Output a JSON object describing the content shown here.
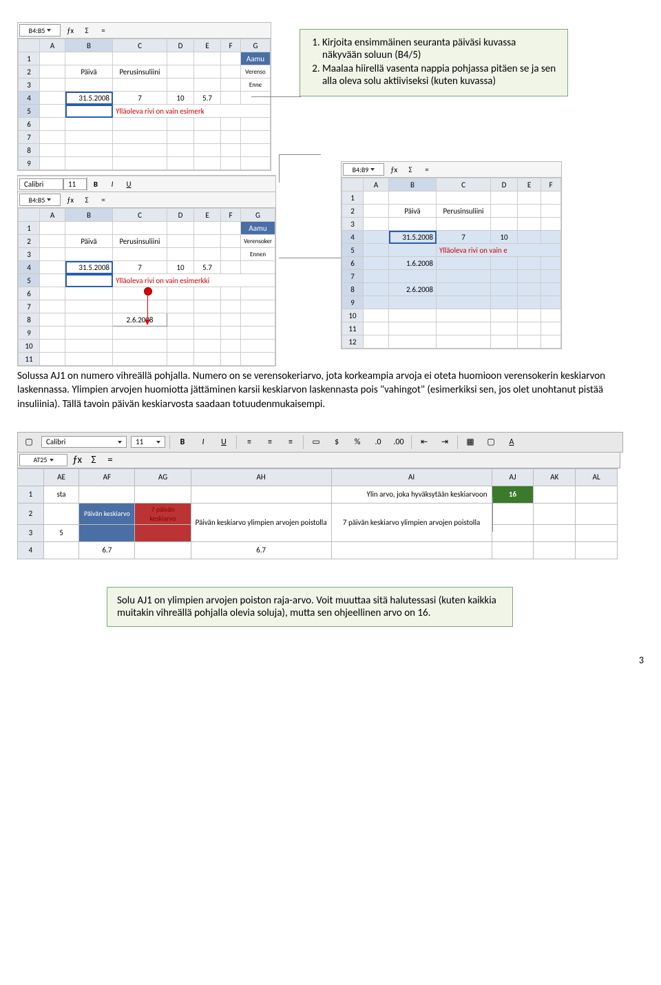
{
  "callout1": {
    "items": [
      "Kirjoita ensimmäinen seuranta päiväsi kuvassa näkyvään soluun (B4/5)",
      "Maalaa hiirellä vasenta nappia pohjassa pitäen se ja sen alla oleva solu aktiiviseksi (kuten kuvassa)"
    ]
  },
  "sheet1": {
    "ref": "B4:B5",
    "cols": [
      "A",
      "B",
      "C",
      "D",
      "E",
      "F",
      "G"
    ],
    "rows": [
      "1",
      "2",
      "3",
      "4",
      "5",
      "6",
      "7",
      "8",
      "9"
    ],
    "r2": {
      "b": "Päivä",
      "c": "Perusinsuliini"
    },
    "g1": "Aamu",
    "g2": "Verenso",
    "g3": "Enne",
    "r4": {
      "b": "31.5.2008",
      "c": "7",
      "d": "10",
      "e": "5.7"
    },
    "r5": {
      "c": "Ylläoleva rivi on vain esimerk"
    }
  },
  "sheet2": {
    "ref": "B4:B5",
    "cols": [
      "A",
      "B",
      "C",
      "D",
      "E",
      "F",
      "G"
    ],
    "rows": [
      "1",
      "2",
      "3",
      "4",
      "5",
      "6",
      "7",
      "8",
      "9",
      "10",
      "11"
    ],
    "r2": {
      "b": "Päivä",
      "c": "Perusinsuliini"
    },
    "g1": "Aamu",
    "g2": "Verensoker",
    "g3": "Ennen",
    "r4": {
      "b": "31.5.2008",
      "c": "7",
      "d": "10",
      "e": "5.7"
    },
    "r5": {
      "c": "Ylläoleva rivi on vain esimerkki"
    },
    "r8": {
      "c": "2.6.2008"
    }
  },
  "sheet3": {
    "ref": "B4:B9",
    "cols": [
      "A",
      "B",
      "C",
      "D",
      "E",
      "F"
    ],
    "rows": [
      "1",
      "2",
      "3",
      "4",
      "5",
      "6",
      "7",
      "8",
      "9",
      "10",
      "11",
      "12"
    ],
    "r2": {
      "b": "Päivä",
      "c": "Perusinsuliini"
    },
    "r4": {
      "b": "31.5.2008",
      "c": "7",
      "d": "10"
    },
    "r5": {
      "c": "Ylläoleva rivi on vain e"
    },
    "r6b": "1.6.2008",
    "r8b": "2.6.2008"
  },
  "para1": "Solussa AJ1 on numero vihreällä pohjalla. Numero on se verensokeriarvo, jota korkeampia arvoja ei oteta huomioon verensokerin keskiarvon laskennassa. Ylimpien arvojen huomiotta jättäminen karsii keskiarvon laskennasta pois \"vahingot\" (esimerkiksi sen, jos olet unohtanut pistää insuliinia). Tällä tavoin päivän keskiarvosta saadaan totuudenmukaisempi.",
  "toolbar": {
    "font": "Calibri",
    "size": "11",
    "ref": "AT25",
    "b": "B",
    "i": "I",
    "u": "U",
    "pct": "%"
  },
  "big": {
    "cols": [
      "AE",
      "AF",
      "AG",
      "AH",
      "AI",
      "AJ",
      "AK",
      "AL"
    ],
    "rows": [
      "1",
      "2",
      "3",
      "4"
    ],
    "r1_ae": "sta",
    "r1_ai": "Ylin arvo, joka hyväksytään keskiarvoon",
    "r1_aj": "16",
    "r2_af": "Päivän keskiarvo",
    "r2_ag": "7 päivän keskiarvo",
    "r2_ah": "Päivän keskiarvo ylimpien arvojen poistolla",
    "r2_ai": "7 päivän keskiarvo ylimpien arvojen poistolla",
    "r3_ae": "5",
    "r4_af": "6.7",
    "r4_ah": "6.7"
  },
  "callout2": "Solu AJ1 on ylimpien arvojen poiston raja-arvo. Voit muuttaa sitä halutessasi (kuten kaikkia muitakin vihreällä pohjalla olevia soluja), mutta sen ohjeellinen arvo on 16.",
  "pagenum": "3",
  "icons": {
    "fx": "ƒx",
    "sigma": "Σ",
    "eq": "="
  }
}
